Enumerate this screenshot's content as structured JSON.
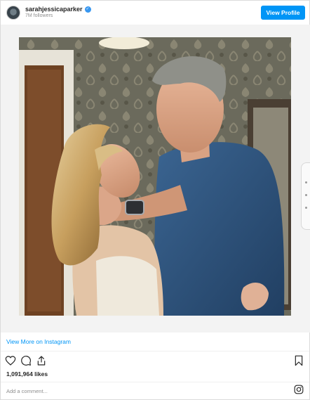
{
  "header": {
    "username": "sarahjessicaparker",
    "followers": "7M followers",
    "view_profile_label": "View Profile"
  },
  "post": {
    "view_more_label": "View More on Instagram",
    "likes": "1,091,964 likes",
    "comment_placeholder": "Add a comment..."
  },
  "colors": {
    "accent": "#0095f6",
    "wallpaper": "#6b6a5c",
    "shirt": "#2f5680"
  },
  "icons": [
    "verified-badge-icon",
    "heart-icon",
    "comment-icon",
    "share-icon",
    "bookmark-icon",
    "instagram-logo-icon"
  ]
}
